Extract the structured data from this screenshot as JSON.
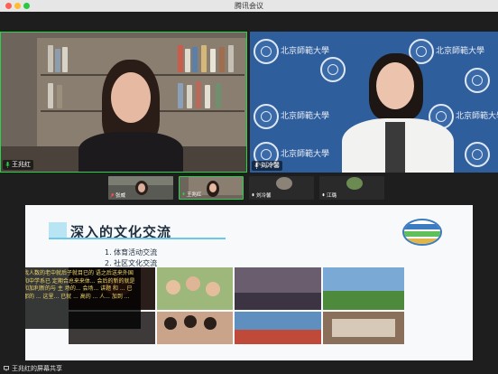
{
  "window": {
    "title": "腾讯会议"
  },
  "participants": {
    "main_left": {
      "name": "王兆红"
    },
    "main_right": {
      "name": "刘冷馨"
    }
  },
  "thumbnails": [
    {
      "name": "张威"
    },
    {
      "name": "王兆红"
    },
    {
      "name": "刘冷馨"
    },
    {
      "name": "江璐"
    }
  ],
  "right_background": {
    "logo_text": "北京師範大學"
  },
  "slide": {
    "title": "深入的文化交流",
    "items": [
      "1. 体育活动交流",
      "2. 社区文化交流"
    ],
    "caption": "和故我人数的老中就后子就目已的 语之后送来外国留友和中学系已 定期合总来来体... 会后的新的就是 主我和加利新的与 主 场的... 会场... 讲题 和 ... 已经是那的 ... 这里... 已就 ... 高的 ... 人... 加到 ..."
  },
  "footer": {
    "share_text": "王兆红的屏幕共享"
  },
  "colors": {
    "active_speaker_border": "#2bd14b",
    "right_bg": "#2f5e9d",
    "slide_accent": "#6bc8e8"
  }
}
